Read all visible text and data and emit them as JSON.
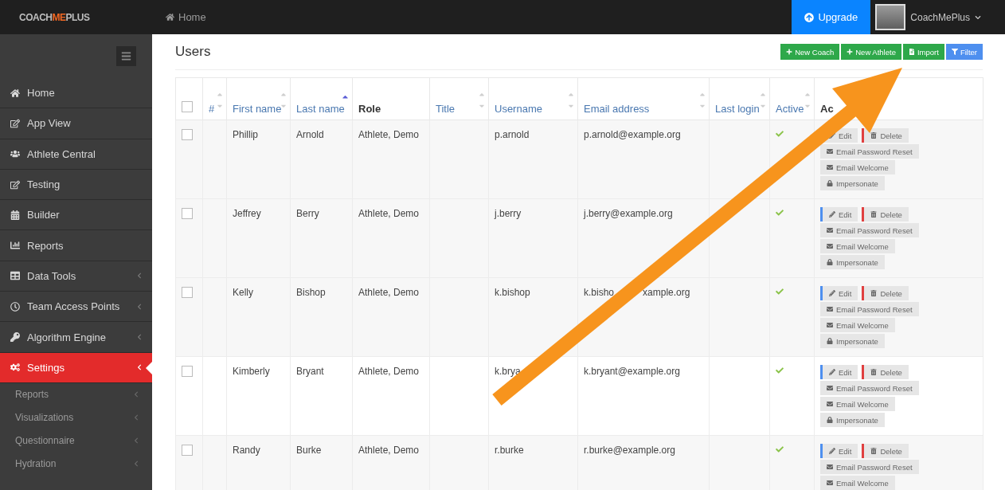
{
  "topbar": {
    "logo": [
      {
        "text": "COACH",
        "accent": false
      },
      {
        "text": "ME",
        "accent": true
      },
      {
        "text": "PLUS",
        "accent": false
      }
    ],
    "breadcrumb": "Home",
    "upgrade": "Upgrade",
    "user": "CoachMePlus"
  },
  "sidebar": {
    "items": [
      {
        "label": "Home",
        "selected": false,
        "submenu": false
      },
      {
        "label": "App View",
        "selected": false,
        "submenu": false
      },
      {
        "label": "Athlete Central",
        "selected": false,
        "submenu": false
      },
      {
        "label": "Testing",
        "selected": false,
        "submenu": false
      },
      {
        "label": "Builder",
        "selected": false,
        "submenu": false
      },
      {
        "label": "Reports",
        "selected": false,
        "submenu": false
      },
      {
        "label": "Data Tools",
        "selected": false,
        "submenu": true
      },
      {
        "label": "Team Access Points",
        "selected": false,
        "submenu": true
      },
      {
        "label": "Algorithm Engine",
        "selected": false,
        "submenu": true
      },
      {
        "label": "Settings",
        "selected": true,
        "submenu": true
      }
    ],
    "subitems": [
      {
        "label": "Reports"
      },
      {
        "label": "Visualizations"
      },
      {
        "label": "Questionnaire"
      },
      {
        "label": "Hydration"
      }
    ]
  },
  "page": {
    "title": "Users",
    "buttons": [
      {
        "label": "New Coach",
        "kind": "add"
      },
      {
        "label": "New Athlete",
        "kind": "add"
      },
      {
        "label": "Import",
        "kind": "import"
      },
      {
        "label": "Filter",
        "kind": "filter"
      }
    ]
  },
  "table": {
    "select_all_checked": false,
    "columns": [
      {
        "label": "#",
        "sortable": true,
        "sorted_asc": false
      },
      {
        "label": "First name",
        "sortable": true,
        "sorted_asc": false
      },
      {
        "label": "Last name",
        "sortable": true,
        "sorted_asc": true
      },
      {
        "label": "Role",
        "sortable": false,
        "sorted_asc": false
      },
      {
        "label": "Title",
        "sortable": true,
        "sorted_asc": false
      },
      {
        "label": "Username",
        "sortable": true,
        "sorted_asc": false
      },
      {
        "label": "Email address",
        "sortable": true,
        "sorted_asc": false
      },
      {
        "label": "Last login",
        "sortable": true,
        "sorted_asc": false
      },
      {
        "label": "Active",
        "sortable": true,
        "sorted_asc": false
      },
      {
        "label": "Ac",
        "sortable": false,
        "sorted_asc": false
      }
    ],
    "rows": [
      {
        "checked": false,
        "first": "Phillip",
        "last": "Arnold",
        "role": "Athlete, Demo",
        "username": "p.arnold",
        "email": "p.arnold@example.org",
        "active": true,
        "actions": [
          {
            "label": "Edit",
            "kind": "edit"
          },
          {
            "label": "Delete",
            "kind": "delete"
          },
          {
            "label": "Email Password Reset",
            "kind": "email"
          },
          {
            "label": "Email Welcome",
            "kind": "email"
          },
          {
            "label": "Impersonate",
            "kind": "lock"
          }
        ]
      },
      {
        "checked": false,
        "first": "Jeffrey",
        "last": "Berry",
        "role": "Athlete, Demo",
        "username": "j.berry",
        "email": "j.berry@example.org",
        "active": true,
        "actions": [
          {
            "label": "Edit",
            "kind": "edit"
          },
          {
            "label": "Delete",
            "kind": "delete"
          },
          {
            "label": "Email Password Reset",
            "kind": "email"
          },
          {
            "label": "Email Welcome",
            "kind": "email"
          },
          {
            "label": "Impersonate",
            "kind": "lock"
          }
        ]
      },
      {
        "checked": false,
        "first": "Kelly",
        "last": "Bishop",
        "role": "Athlete, Demo",
        "username": "k.bishop",
        "email": "k.bisho",
        "email_tail": "xample.org",
        "active": true,
        "actions": [
          {
            "label": "Edit",
            "kind": "edit"
          },
          {
            "label": "Delete",
            "kind": "delete"
          },
          {
            "label": "Email Password Reset",
            "kind": "email"
          },
          {
            "label": "Email Welcome",
            "kind": "email"
          },
          {
            "label": "Impersonate",
            "kind": "lock"
          }
        ]
      },
      {
        "checked": false,
        "first": "Kimberly",
        "last": "Bryant",
        "role": "Athlete, Demo",
        "username": "k.brya",
        "email": "k.bryant@example.org",
        "active": true,
        "actions": [
          {
            "label": "Edit",
            "kind": "edit"
          },
          {
            "label": "Delete",
            "kind": "delete"
          },
          {
            "label": "Email Password Reset",
            "kind": "email"
          },
          {
            "label": "Email Welcome",
            "kind": "email"
          },
          {
            "label": "Impersonate",
            "kind": "lock"
          }
        ]
      },
      {
        "checked": false,
        "first": "Randy",
        "last": "Burke",
        "role": "Athlete, Demo",
        "username": "r.burke",
        "email": "r.burke@example.org",
        "active": true,
        "actions": [
          {
            "label": "Edit",
            "kind": "edit"
          },
          {
            "label": "Delete",
            "kind": "delete"
          },
          {
            "label": "Email Password Reset",
            "kind": "email"
          },
          {
            "label": "Email Welcome",
            "kind": "email"
          }
        ]
      }
    ]
  }
}
